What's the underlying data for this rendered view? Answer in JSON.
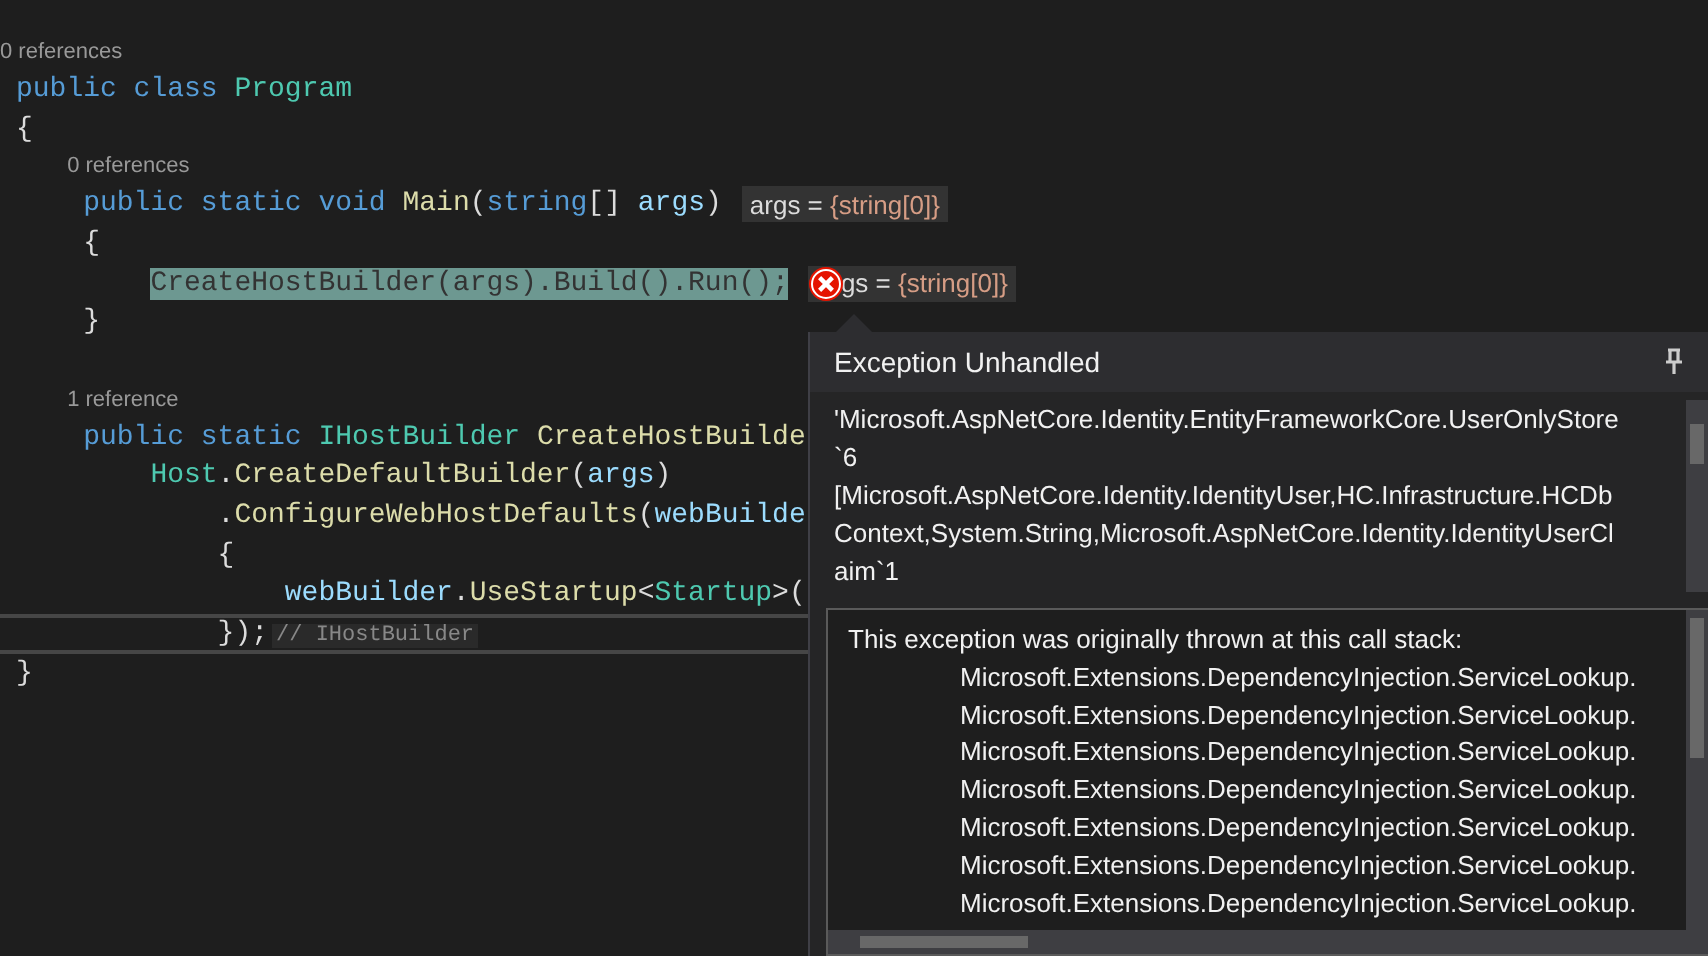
{
  "editor": {
    "lines": [
      {
        "kind": "lens",
        "text": "0 references"
      },
      {
        "kind": "code",
        "current": false,
        "tokens": [
          {
            "kind": "kw",
            "t": "public class "
          },
          {
            "kind": "type",
            "t": "Program"
          }
        ]
      },
      {
        "kind": "code",
        "current": false,
        "tokens": [
          {
            "kind": "plain",
            "t": "{"
          }
        ]
      },
      {
        "kind": "lens",
        "text": "    0 references"
      },
      {
        "kind": "code",
        "current": false,
        "tokens": [
          {
            "kind": "kw",
            "t": "    public static void "
          },
          {
            "kind": "method",
            "t": "Main"
          },
          {
            "kind": "plain",
            "t": "("
          },
          {
            "kind": "kw",
            "t": "string"
          },
          {
            "kind": "plain",
            "t": "[] "
          },
          {
            "kind": "param",
            "t": "args"
          },
          {
            "kind": "plain",
            "t": ")"
          }
        ],
        "datatip": {
          "error": false,
          "name": "args = ",
          "value": "{string[0]}"
        }
      },
      {
        "kind": "code",
        "current": false,
        "tokens": [
          {
            "kind": "plain",
            "t": "    {"
          }
        ]
      },
      {
        "kind": "code",
        "current": false,
        "tokens": [
          {
            "kind": "highlight",
            "t": "        CreateHostBuilder(args).Build().Run();"
          }
        ],
        "datatip": {
          "error": true,
          "name": "gs = ",
          "value": "{string[0]}"
        }
      },
      {
        "kind": "code",
        "current": false,
        "tokens": [
          {
            "kind": "plain",
            "t": "    }"
          }
        ]
      },
      {
        "kind": "blank"
      },
      {
        "kind": "lens",
        "text": "    1 reference"
      },
      {
        "kind": "code",
        "current": false,
        "tokens": [
          {
            "kind": "kw",
            "t": "    public static "
          },
          {
            "kind": "type",
            "t": "IHostBuilder "
          },
          {
            "kind": "method",
            "t": "CreateHostBuilde"
          }
        ]
      },
      {
        "kind": "code",
        "current": false,
        "tokens": [
          {
            "kind": "type",
            "t": "        Host"
          },
          {
            "kind": "plain",
            "t": "."
          },
          {
            "kind": "method",
            "t": "CreateDefaultBuilder"
          },
          {
            "kind": "plain",
            "t": "("
          },
          {
            "kind": "param",
            "t": "args"
          },
          {
            "kind": "plain",
            "t": ")"
          }
        ]
      },
      {
        "kind": "code",
        "current": false,
        "tokens": [
          {
            "kind": "plain",
            "t": "            ."
          },
          {
            "kind": "method",
            "t": "ConfigureWebHostDefaults"
          },
          {
            "kind": "plain",
            "t": "("
          },
          {
            "kind": "param",
            "t": "webBuilde"
          }
        ]
      },
      {
        "kind": "code",
        "current": false,
        "tokens": [
          {
            "kind": "plain",
            "t": "            {"
          }
        ]
      },
      {
        "kind": "code",
        "current": false,
        "tokens": [
          {
            "kind": "param",
            "t": "                webBuilder"
          },
          {
            "kind": "plain",
            "t": "."
          },
          {
            "kind": "method",
            "t": "UseStartup"
          },
          {
            "kind": "plain",
            "t": "<"
          },
          {
            "kind": "type",
            "t": "Startup"
          },
          {
            "kind": "plain",
            "t": ">("
          }
        ]
      },
      {
        "kind": "code",
        "current": true,
        "tokens": [
          {
            "kind": "plain",
            "t": "            });"
          },
          {
            "kind": "hint",
            "t": "// IHostBuilder"
          }
        ]
      },
      {
        "kind": "code",
        "current": false,
        "tokens": [
          {
            "kind": "plain",
            "t": "}"
          }
        ]
      }
    ]
  },
  "exception_popup": {
    "title": "Exception Unhandled",
    "message_lines": [
      "'Microsoft.AspNetCore.Identity.EntityFrameworkCore.UserOnlyStore",
      "`6",
      "[Microsoft.AspNetCore.Identity.IdentityUser,HC.Infrastructure.HCDb",
      "Context,System.String,Microsoft.AspNetCore.Identity.IdentityUserCl",
      "aim`1"
    ],
    "call_stack": {
      "heading": "This exception was originally thrown at this call stack:",
      "frames": [
        "Microsoft.Extensions.DependencyInjection.ServiceLookup.",
        "Microsoft.Extensions.DependencyInjection.ServiceLookup.",
        "Microsoft.Extensions.DependencyInjection.ServiceLookup.",
        "Microsoft.Extensions.DependencyInjection.ServiceLookup.",
        "Microsoft.Extensions.DependencyInjection.ServiceLookup.",
        "Microsoft.Extensions.DependencyInjection.ServiceLookup.",
        "Microsoft.Extensions.DependencyInjection.ServiceLookup."
      ]
    }
  }
}
